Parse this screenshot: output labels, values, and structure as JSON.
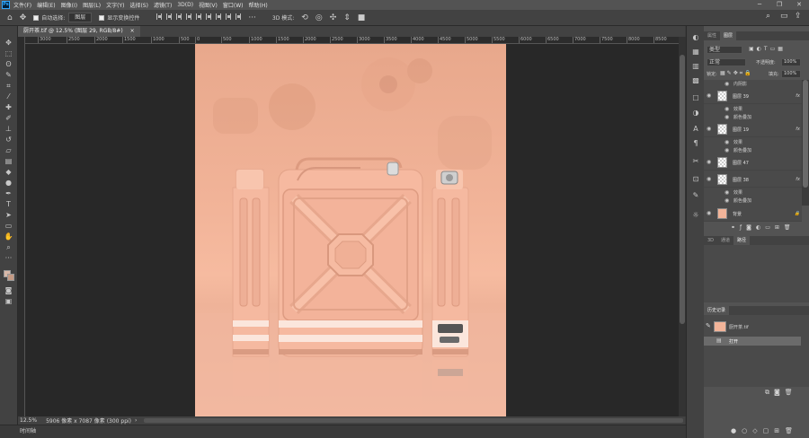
{
  "menubar": {
    "app_icon": "Ps",
    "items": [
      "文件(F)",
      "编辑(E)",
      "图像(I)",
      "图层(L)",
      "文字(Y)",
      "选择(S)",
      "滤镜(T)",
      "3D(D)",
      "视图(V)",
      "窗口(W)",
      "帮助(H)"
    ]
  },
  "options": {
    "auto_select": "自动选择:",
    "auto_select_target": "图层",
    "show_transform": "显示变换控件",
    "mode_3d": "3D 模式:"
  },
  "document_tab": {
    "title": "厨开茶.tif @ 12.5% (图层 29, RGB/8#)",
    "close": "×"
  },
  "ruler": {
    "labels": [
      "3000",
      "2500",
      "2000",
      "1500",
      "1000",
      "500",
      "0",
      "500",
      "1000",
      "1500",
      "2000",
      "2500",
      "3000",
      "3500",
      "4000",
      "4500",
      "5000",
      "5500",
      "6000",
      "6500",
      "7000",
      "7500",
      "8000",
      "8500"
    ]
  },
  "status": {
    "zoom": "12.5%",
    "doc_info": "5906 像素 x 7087 像素 (300 ppi)",
    "arrow": "›"
  },
  "timeline_label": "时间轴",
  "layers_panel": {
    "tabs": [
      "属性",
      "图层"
    ],
    "filter_kind": "类型",
    "blend_mode": "正常",
    "opacity_label": "不透明度:",
    "opacity_value": "100%",
    "lock_label": "锁定:",
    "fill_label": "填充:",
    "fill_value": "100%",
    "layers": [
      {
        "type": "sub",
        "name": "内阴影"
      },
      {
        "type": "layer",
        "name": "图层 39",
        "fx": "fx"
      },
      {
        "type": "sub",
        "name": "效果"
      },
      {
        "type": "sub",
        "name": "颜色叠加"
      },
      {
        "type": "layer",
        "name": "图层 19",
        "fx": "fx"
      },
      {
        "type": "sub",
        "name": "效果"
      },
      {
        "type": "sub",
        "name": "颜色叠加"
      },
      {
        "type": "layer",
        "name": "图层 47",
        "fx": ""
      },
      {
        "type": "layer",
        "name": "图层 38",
        "fx": "fx"
      },
      {
        "type": "sub",
        "name": "效果"
      },
      {
        "type": "sub",
        "name": "颜色叠加"
      },
      {
        "type": "layer",
        "name": "背景",
        "fx": ""
      }
    ]
  },
  "adjust_panel": {
    "tabs": [
      "3D",
      "通道",
      "路径"
    ]
  },
  "history_panel": {
    "tab": "历史记录",
    "snapshot": "厨开茶.tif",
    "steps": [
      "打开"
    ]
  },
  "colors": {
    "accent": "#31a8ff",
    "canvas_bg": "#f2b499",
    "can": "#f6b9a0"
  }
}
